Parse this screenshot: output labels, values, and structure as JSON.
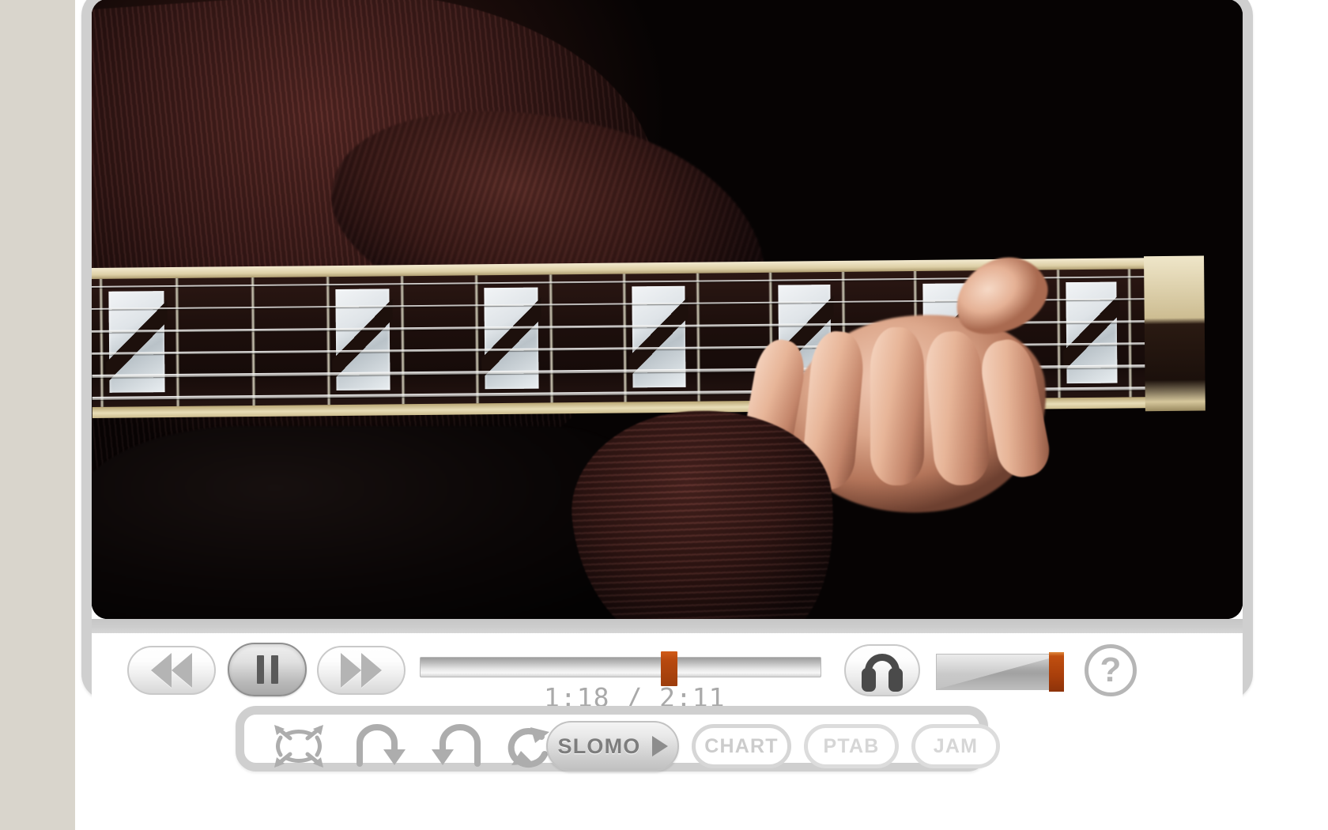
{
  "theme": {
    "page_bg": "#d9d5cc",
    "panel_bg": "#ffffff",
    "chrome_gray": "#cfcfcf",
    "accent_orange": "#b8490f",
    "text_gray": "#a9a9a9"
  },
  "video": {
    "name": "guitar-lesson-video",
    "description": "Close-up of a guitarist's left hand fretting a chord on an archtop guitar neck against a black background"
  },
  "transport": {
    "rewind": {
      "label": "Rewind",
      "icon": "rewind-icon"
    },
    "pause": {
      "label": "Pause",
      "icon": "pause-icon",
      "state": "pressed"
    },
    "fast_forward": {
      "label": "Fast Forward",
      "icon": "fast-forward-icon"
    },
    "scrubber": {
      "name": "playback-scrubber",
      "position_percent": 62,
      "current_time": "1:18",
      "total_time": "2:11",
      "time_display": "1:18 / 2:11"
    },
    "headphones": {
      "label": "Headphones",
      "icon": "headphones-icon"
    },
    "volume": {
      "name": "volume-slider",
      "level_percent": 97
    },
    "help": {
      "label": "?",
      "name": "help-button"
    }
  },
  "toolbar": {
    "buttons": [
      {
        "name": "fullscreen-expand-icon",
        "label": "Expand",
        "type": "icon"
      },
      {
        "name": "loop-start-icon",
        "label": "Set Loop Start",
        "type": "icon"
      },
      {
        "name": "loop-end-icon",
        "label": "Set Loop End",
        "type": "icon"
      },
      {
        "name": "loop-repeat-icon",
        "label": "Loop",
        "type": "icon"
      }
    ],
    "slomo": {
      "label": "SLOMO",
      "state": "active"
    },
    "chart": {
      "label": "CHART",
      "state": "disabled"
    },
    "ptab": {
      "label": "PTAB",
      "state": "disabled"
    },
    "jam": {
      "label": "JAM",
      "state": "disabled"
    }
  }
}
